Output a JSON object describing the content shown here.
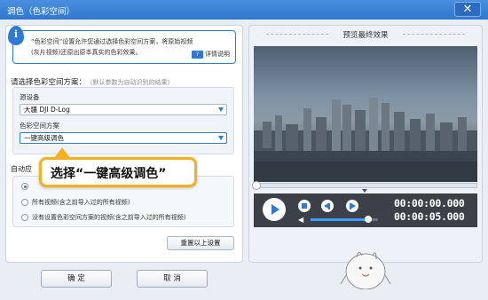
{
  "window": {
    "title": "调色（色彩空间）",
    "close_glyph": "✕"
  },
  "info": {
    "icon": "i",
    "line1": "“色彩空间”设置允许您通过选择色彩空间方案，将原始视频",
    "line2": "(灰片视频)还原出原本真实的色彩效果。",
    "help_badge": "?",
    "help_label": "详情说明"
  },
  "color_space": {
    "title": "请选择色彩空间方案：",
    "hint": "（默认参数为自动识别的结果）",
    "device_label": "源设备",
    "device_value": "大疆 DJI D-Log",
    "scheme_label": "色彩空间方案",
    "scheme_value": "一键高级调色"
  },
  "apply": {
    "label": "自动应",
    "options": [
      {
        "label": "",
        "checked": true
      },
      {
        "label": "所有视频(含之前导入过的所有视频)",
        "checked": false
      },
      {
        "label": "没有设置色彩空间方案的视频(含之前导入过的所有视频)",
        "checked": false
      }
    ],
    "reset_label": "重置以上设置"
  },
  "callout": {
    "text": "选择“一键高级调色”"
  },
  "buttons": {
    "ok": "确 定",
    "cancel": "取 消"
  },
  "preview": {
    "title": "预览最终效果",
    "current_time": "00:00:00.000",
    "total_time": "00:00:05.000",
    "volume_level": 0.85,
    "progress": 0
  },
  "colors": {
    "accent": "#2d7bd6",
    "callout_border": "#f3b11d",
    "titlebar": "#3a84d8"
  }
}
